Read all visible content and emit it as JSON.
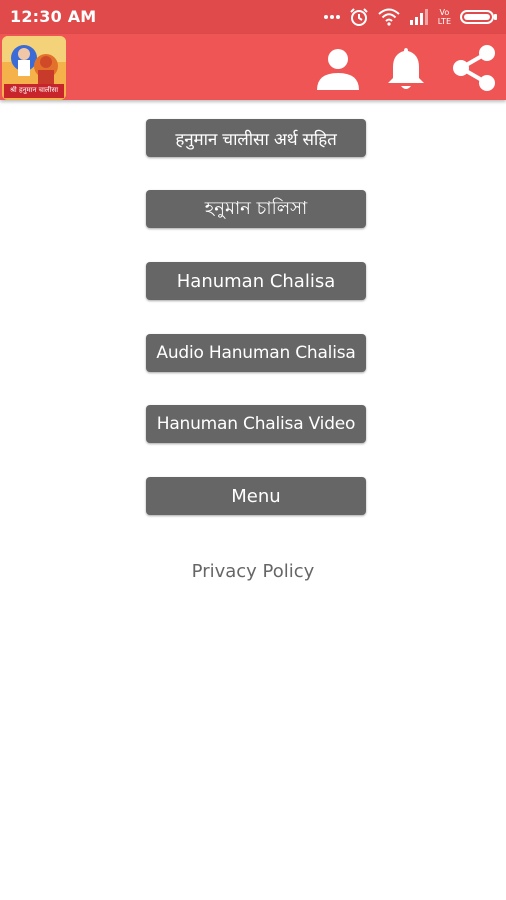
{
  "status_bar": {
    "time": "12:30 AM",
    "icons": [
      "more-dots-icon",
      "alarm-icon",
      "wifi-icon",
      "signal-icon",
      "volte-lte-icon",
      "battery-icon"
    ],
    "network_label_top": "Vo",
    "network_label_bottom": "LTE"
  },
  "app_bar": {
    "logo_caption": "श्री हनुमान चालीसा",
    "actions": [
      "profile-icon",
      "bell-icon",
      "share-icon"
    ],
    "color": "#f05555"
  },
  "menu": {
    "buttons": [
      {
        "label": "हनुमान चालीसा अर्थ सहित"
      },
      {
        "label": "হনুমান চালিসা"
      },
      {
        "label": "Hanuman Chalisa"
      },
      {
        "label": "Audio Hanuman Chalisa"
      },
      {
        "label": "Hanuman Chalisa Video"
      },
      {
        "label": "Menu"
      }
    ],
    "privacy_label": "Privacy Policy"
  },
  "colors": {
    "status_bar": "#e04a4a",
    "button_bg": "#666666",
    "button_text": "#ffffff"
  }
}
